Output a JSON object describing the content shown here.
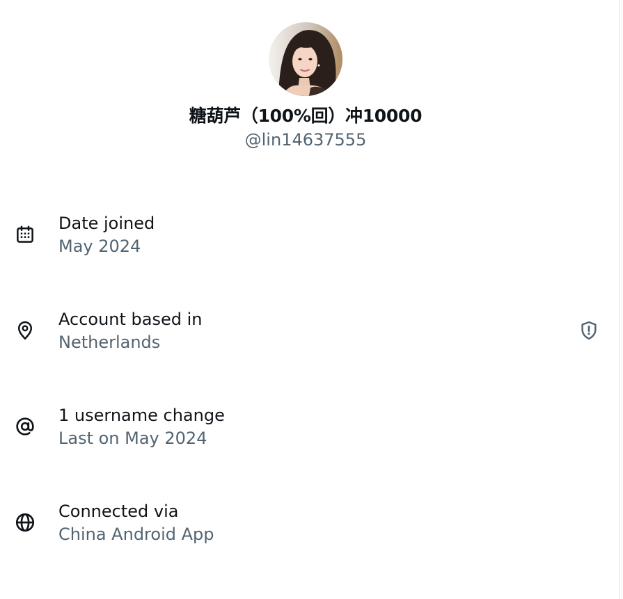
{
  "profile": {
    "display_name": "糖葫芦（100%回）冲10000",
    "handle": "@lin14637555",
    "avatar_icon": "profile-photo"
  },
  "about": {
    "items": [
      {
        "icon": "calendar-icon",
        "label": "Date joined",
        "value": "May 2024"
      },
      {
        "icon": "location-pin-icon",
        "label": "Account based in",
        "value": "Netherlands",
        "trailing_icon": "shield-alert-icon"
      },
      {
        "icon": "at-sign-icon",
        "label": "1 username change",
        "value": "Last on May 2024"
      },
      {
        "icon": "globe-icon",
        "label": "Connected via",
        "value": "China Android App"
      }
    ]
  },
  "colors": {
    "primary_text": "#0f1419",
    "secondary_text": "#536471"
  }
}
